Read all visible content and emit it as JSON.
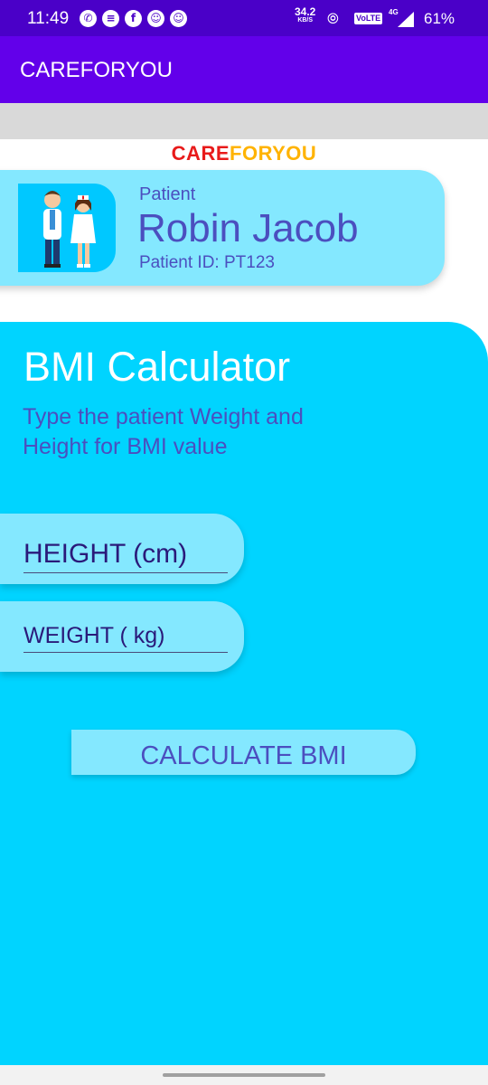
{
  "status_bar": {
    "time": "11:49",
    "net_speed_value": "34.2",
    "net_speed_unit": "KB/S",
    "volte": "VoLTE",
    "network_type": "4G",
    "battery": "61%",
    "notification_icons": [
      "whatsapp-icon",
      "messages-icon",
      "facebook-icon",
      "snapchat-icon",
      "snapchat-icon"
    ]
  },
  "appbar": {
    "title": "CAREFORYOU"
  },
  "logo": {
    "part1": "CARE",
    "part2": "FORYOU",
    "color1": "#e81b1b",
    "color2": "#ffb300"
  },
  "patient": {
    "label": "Patient",
    "name": "Robin Jacob",
    "id_text": "Patient ID: PT123"
  },
  "bmi": {
    "title": "BMI Calculator",
    "subtitle": "Type the patient Weight and Height for BMI value",
    "height_placeholder": "HEIGHT (cm)",
    "weight_placeholder": "WEIGHT ( kg)",
    "calculate_label": "CALCULATE BMI"
  },
  "colors": {
    "statusbar": "#4a00c8",
    "appbar": "#6200ea",
    "panel": "#00d4ff",
    "card": "#84e8ff",
    "accent_text": "#4b4fbf"
  }
}
